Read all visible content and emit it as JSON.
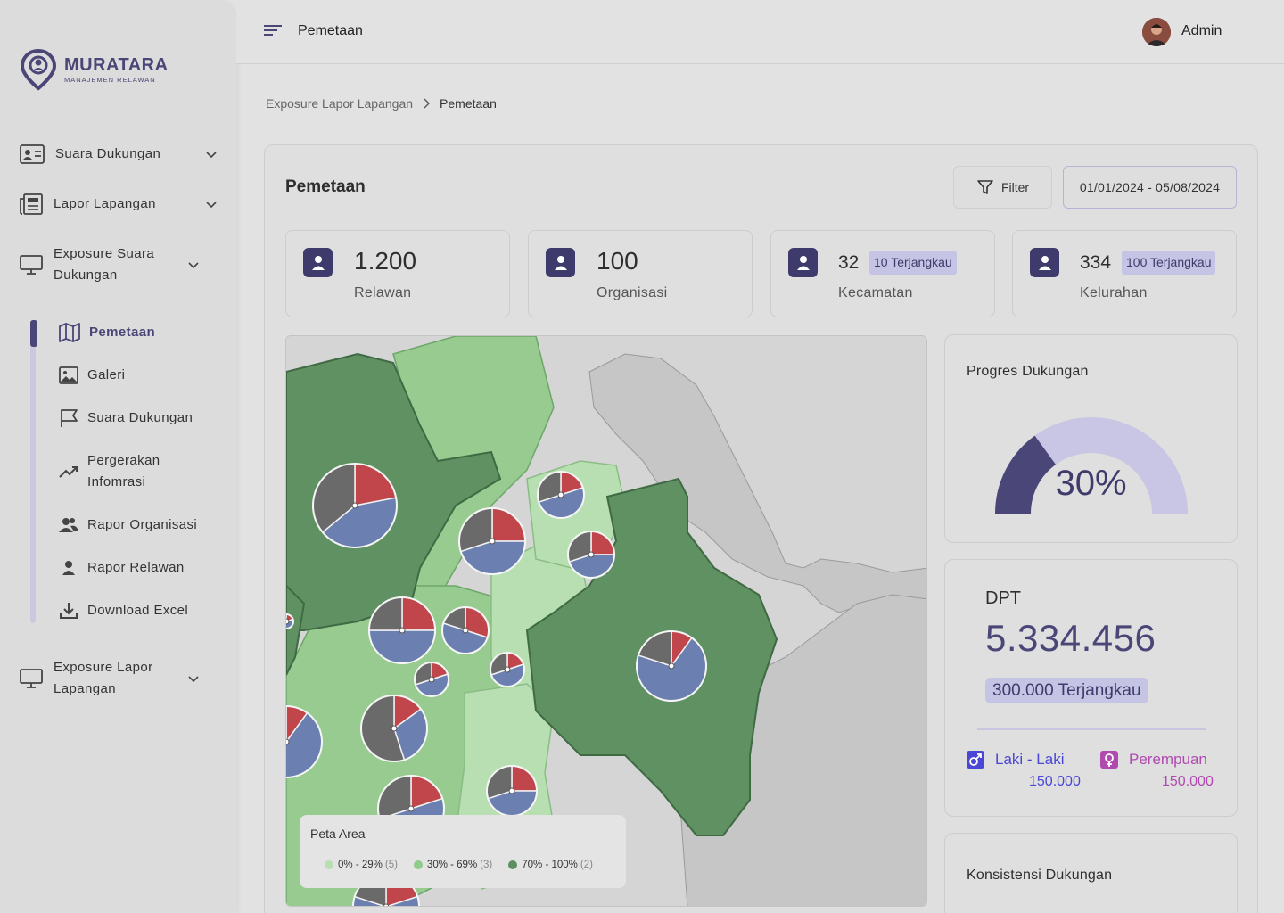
{
  "brand": {
    "title": "MURATARA",
    "subtitle": "MANAJEMEN RELAWAN"
  },
  "sidebar": {
    "items": [
      {
        "label": "Suara  Dukungan",
        "icon": "id-card-icon"
      },
      {
        "label": "Lapor Lapangan",
        "icon": "newspaper-icon"
      },
      {
        "label": "Exposure Suara Dukungan",
        "icon": "monitor-icon"
      },
      {
        "label": "Exposure Lapor Lapangan",
        "icon": "monitor-icon"
      }
    ],
    "sub_items": [
      {
        "label": "Pemetaan",
        "icon": "map-icon",
        "active": true
      },
      {
        "label": "Galeri",
        "icon": "image-icon"
      },
      {
        "label": "Suara Dukungan",
        "icon": "flag-icon"
      },
      {
        "label": "Pergerakan Infomrasi",
        "icon": "trend-icon"
      },
      {
        "label": "Rapor Organisasi",
        "icon": "users-icon"
      },
      {
        "label": "Rapor Relawan",
        "icon": "user-icon"
      },
      {
        "label": "Download Excel",
        "icon": "download-icon"
      }
    ]
  },
  "topbar": {
    "title": "Pemetaan",
    "user": "Admin"
  },
  "breadcrumb": {
    "parent": "Exposure Lapor Lapangan",
    "current": "Pemetaan"
  },
  "main": {
    "title": "Pemetaan",
    "filter_label": "Filter",
    "date_range": "01/01/2024 - 05/08/2024"
  },
  "stats": [
    {
      "value": "1.200",
      "label": "Relawan"
    },
    {
      "value": "100",
      "label": "Organisasi"
    },
    {
      "value": "32",
      "badge": "10 Terjangkau",
      "label": "Kecamatan"
    },
    {
      "value": "334",
      "badge": "100 Terjangkau",
      "label": "Kelurahan"
    }
  ],
  "legend": {
    "title": "Peta Area",
    "items": [
      {
        "label": "0% - 29%",
        "count": "(5)",
        "color": "#b7dfb2"
      },
      {
        "label": "30% - 69%",
        "count": "(3)",
        "color": "#8fcb8a"
      },
      {
        "label": "70% - 100%",
        "count": "(2)",
        "color": "#5e8f62"
      }
    ]
  },
  "progress": {
    "title": "Progres Dukungan",
    "value_text": "30%",
    "fraction": 0.3
  },
  "dpt": {
    "label": "DPT",
    "value": "5.334.456",
    "badge": "300.000 Terjangkau",
    "male_label": "Laki - Laki",
    "male_value": "150.000",
    "female_label": "Perempuan",
    "female_value": "150.000"
  },
  "konsistensi": {
    "title": "Konsistensi  Dukungan"
  },
  "colors": {
    "accent": "#4a4677",
    "accent_light": "#c6c4e4",
    "male": "#4b47d6",
    "female": "#b04ab0",
    "pie_red": "#c0464b",
    "pie_blue": "#6b80b0",
    "pie_gray": "#6a6a6a"
  }
}
